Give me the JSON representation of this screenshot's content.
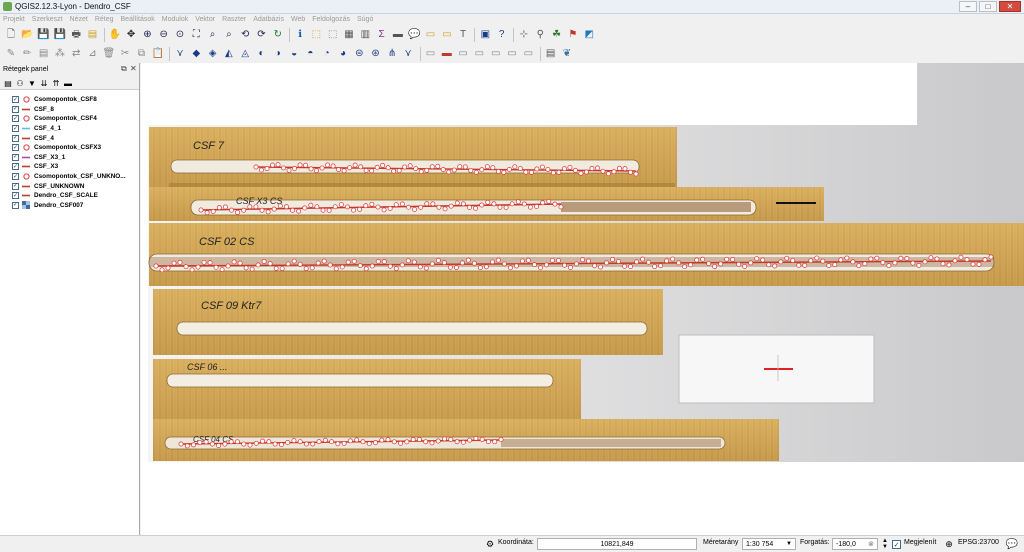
{
  "window": {
    "title": "QGIS2.12.3-Lyon - Dendro_CSF",
    "controls": [
      "–",
      "□",
      "✕"
    ]
  },
  "menu": [
    "Projekt",
    "Szerkeszt",
    "Nézet",
    "Réteg",
    "Beállítások",
    "Modulok",
    "Vektor",
    "Raszter",
    "Adatbázis",
    "Web",
    "Feldolgozás",
    "Súgó"
  ],
  "toolbar1": [
    {
      "icon": "new-project-icon",
      "glyph": "🗋",
      "color": "#555"
    },
    {
      "icon": "open-project-icon",
      "glyph": "📂",
      "color": "#c9a227"
    },
    {
      "icon": "save-project-icon",
      "glyph": "💾",
      "color": "#3b6ea5"
    },
    {
      "icon": "save-as-icon",
      "glyph": "💾",
      "color": "#3b6ea5"
    },
    {
      "icon": "print-composer-icon",
      "glyph": "🖶",
      "color": "#555"
    },
    {
      "icon": "composer-manager-icon",
      "glyph": "▤",
      "color": "#c9a227"
    },
    {
      "icon": "pan-icon",
      "glyph": "✋",
      "color": "#222"
    },
    {
      "icon": "pan-to-selection-icon",
      "glyph": "✥",
      "color": "#222"
    },
    {
      "icon": "zoom-in-icon",
      "glyph": "⊕",
      "color": "#225"
    },
    {
      "icon": "zoom-out-icon",
      "glyph": "⊖",
      "color": "#225"
    },
    {
      "icon": "zoom-actual-icon",
      "glyph": "⊙",
      "color": "#225"
    },
    {
      "icon": "zoom-full-icon",
      "glyph": "⛶",
      "color": "#225"
    },
    {
      "icon": "zoom-selection-icon",
      "glyph": "⌕",
      "color": "#225"
    },
    {
      "icon": "zoom-layer-icon",
      "glyph": "⌕",
      "color": "#225"
    },
    {
      "icon": "zoom-last-icon",
      "glyph": "⟲",
      "color": "#225"
    },
    {
      "icon": "zoom-next-icon",
      "glyph": "⟳",
      "color": "#225"
    },
    {
      "icon": "refresh-icon",
      "glyph": "↻",
      "color": "#2a7a2a"
    },
    {
      "icon": "identify-icon",
      "glyph": "ℹ",
      "color": "#1a5aa5"
    },
    {
      "icon": "select-features-icon",
      "glyph": "⬚",
      "color": "#c9a227"
    },
    {
      "icon": "deselect-icon",
      "glyph": "⬚",
      "color": "#888"
    },
    {
      "icon": "open-attribute-table-icon",
      "glyph": "▦",
      "color": "#555"
    },
    {
      "icon": "field-calculator-icon",
      "glyph": "▥",
      "color": "#555"
    },
    {
      "icon": "statistics-icon",
      "glyph": "Σ",
      "color": "#8a2a8a"
    },
    {
      "icon": "measure-icon",
      "glyph": "▬",
      "color": "#555"
    },
    {
      "icon": "map-tips-icon",
      "glyph": "💬",
      "color": "#c9a227"
    },
    {
      "icon": "new-bookmark-icon",
      "glyph": "▭",
      "color": "#c9a227"
    },
    {
      "icon": "show-bookmarks-icon",
      "glyph": "▭",
      "color": "#c9a227"
    },
    {
      "icon": "text-annotation-icon",
      "glyph": "T",
      "color": "#555"
    },
    {
      "icon": "help-book-icon",
      "glyph": "▣",
      "color": "#1a3a8a"
    },
    {
      "icon": "whats-this-icon",
      "glyph": "?",
      "color": "#1a3a8a"
    },
    {
      "icon": "gps-icon",
      "glyph": "⊹",
      "color": "#555"
    },
    {
      "icon": "georeferencer-icon",
      "glyph": "⚲",
      "color": "#555"
    },
    {
      "icon": "plugin-a-icon",
      "glyph": "☘",
      "color": "#2a7a2a"
    },
    {
      "icon": "plugin-b-icon",
      "glyph": "⚑",
      "color": "#c0392b"
    },
    {
      "icon": "plugin-c-icon",
      "glyph": "◩",
      "color": "#1a7abf"
    }
  ],
  "toolbar2": [
    {
      "icon": "current-edits-icon",
      "glyph": "✎",
      "color": "#888"
    },
    {
      "icon": "toggle-editing-icon",
      "glyph": "✏",
      "color": "#888"
    },
    {
      "icon": "save-edits-icon",
      "glyph": "▤",
      "color": "#888"
    },
    {
      "icon": "add-feature-icon",
      "glyph": "⁂",
      "color": "#888"
    },
    {
      "icon": "move-feature-icon",
      "glyph": "⇄",
      "color": "#888"
    },
    {
      "icon": "node-tool-icon",
      "glyph": "⊿",
      "color": "#888"
    },
    {
      "icon": "delete-selected-icon",
      "glyph": "🗑",
      "color": "#888"
    },
    {
      "icon": "cut-features-icon",
      "glyph": "✂",
      "color": "#888"
    },
    {
      "icon": "copy-features-icon",
      "glyph": "⧉",
      "color": "#888"
    },
    {
      "icon": "paste-features-icon",
      "glyph": "📋",
      "color": "#888"
    },
    {
      "icon": "adv-digitize-a-icon",
      "glyph": "⋎",
      "color": "#1a3a8a"
    },
    {
      "icon": "adv-digitize-b-icon",
      "glyph": "◆",
      "color": "#1a3a8a"
    },
    {
      "icon": "adv-digitize-c-icon",
      "glyph": "◈",
      "color": "#1a3a8a"
    },
    {
      "icon": "adv-digitize-d-icon",
      "glyph": "◭",
      "color": "#1a3a8a"
    },
    {
      "icon": "adv-digitize-e-icon",
      "glyph": "◬",
      "color": "#1a3a8a"
    },
    {
      "icon": "adv-digitize-f-icon",
      "glyph": "◐",
      "color": "#1a3a8a"
    },
    {
      "icon": "adv-digitize-g-icon",
      "glyph": "◑",
      "color": "#1a3a8a"
    },
    {
      "icon": "adv-digitize-h-icon",
      "glyph": "◒",
      "color": "#1a3a8a"
    },
    {
      "icon": "adv-digitize-i-icon",
      "glyph": "◓",
      "color": "#1a3a8a"
    },
    {
      "icon": "adv-digitize-j-icon",
      "glyph": "◔",
      "color": "#1a3a8a"
    },
    {
      "icon": "adv-digitize-k-icon",
      "glyph": "◕",
      "color": "#1a3a8a"
    },
    {
      "icon": "adv-digitize-l-icon",
      "glyph": "⊜",
      "color": "#1a3a8a"
    },
    {
      "icon": "adv-digitize-m-icon",
      "glyph": "⊛",
      "color": "#1a3a8a"
    },
    {
      "icon": "adv-digitize-n-icon",
      "glyph": "⋔",
      "color": "#1a3a8a"
    },
    {
      "icon": "adv-digitize-o-icon",
      "glyph": "⋎",
      "color": "#1a3a8a"
    },
    {
      "icon": "label-a-icon",
      "glyph": "▭",
      "color": "#888"
    },
    {
      "icon": "label-b-icon",
      "glyph": "▬",
      "color": "#c0392b"
    },
    {
      "icon": "label-c-icon",
      "glyph": "▭",
      "color": "#888"
    },
    {
      "icon": "label-d-icon",
      "glyph": "▭",
      "color": "#888"
    },
    {
      "icon": "label-e-icon",
      "glyph": "▭",
      "color": "#888"
    },
    {
      "icon": "label-f-icon",
      "glyph": "▭",
      "color": "#888"
    },
    {
      "icon": "label-g-icon",
      "glyph": "▭",
      "color": "#888"
    },
    {
      "icon": "csw-icon",
      "glyph": "▤",
      "color": "#555"
    },
    {
      "icon": "python-console-icon",
      "glyph": "❦",
      "color": "#3b6ea5"
    }
  ],
  "layers_panel": {
    "title": "Rétegek panel",
    "tools": [
      {
        "icon": "open-layer-styling-icon",
        "glyph": "▤"
      },
      {
        "icon": "add-group-icon",
        "glyph": "⚇"
      },
      {
        "icon": "filter-legend-icon",
        "glyph": "▼"
      },
      {
        "icon": "expand-all-icon",
        "glyph": "⇊"
      },
      {
        "icon": "collapse-all-icon",
        "glyph": "⇈"
      },
      {
        "icon": "remove-layer-icon",
        "glyph": "▬"
      }
    ],
    "layers": [
      {
        "name": "Csomopontok_CSF8",
        "checked": true,
        "symbol": "circle",
        "color": "#e04040"
      },
      {
        "name": "CSF_8",
        "checked": true,
        "symbol": "line",
        "color": "#c0392b"
      },
      {
        "name": "Csomopontok_CSF4",
        "checked": true,
        "symbol": "circle",
        "color": "#e04040"
      },
      {
        "name": "CSF_4_1",
        "checked": true,
        "symbol": "line",
        "color": "#5bc0de"
      },
      {
        "name": "CSF_4",
        "checked": true,
        "symbol": "line",
        "color": "#c0392b"
      },
      {
        "name": "Csomopontok_CSFX3",
        "checked": true,
        "symbol": "circle",
        "color": "#e04040"
      },
      {
        "name": "CSF_X3_1",
        "checked": true,
        "symbol": "line",
        "color": "#c03fb0"
      },
      {
        "name": "CSF_X3",
        "checked": true,
        "symbol": "line",
        "color": "#c0392b"
      },
      {
        "name": "Csomopontok_CSF_UNKNO...",
        "checked": true,
        "symbol": "circle",
        "color": "#e04040"
      },
      {
        "name": "CSF_UNKNOWN",
        "checked": true,
        "symbol": "line",
        "color": "#c0392b"
      },
      {
        "name": "Dendro_CSF_SCALE",
        "checked": true,
        "symbol": "line",
        "color": "#c0392b"
      },
      {
        "name": "Dendro_CSF007",
        "checked": true,
        "symbol": "raster",
        "color": "#3b6ea5"
      }
    ]
  },
  "map": {
    "cores": [
      {
        "label": "CSF 7",
        "points": true
      },
      {
        "label": "CSF X3 CS",
        "points": true
      },
      {
        "label": "CSF 02 CS",
        "points": true
      },
      {
        "label": "CSF 09 Ktr7",
        "points": false
      },
      {
        "label": "CSF 06 ...",
        "points": false
      },
      {
        "label": "CSF 04 CS",
        "points": true
      }
    ]
  },
  "status": {
    "coord_label": "Koordináta:",
    "coord_value": "10821,849",
    "scale_label": "Méretarány",
    "scale_value": "1:30 754",
    "rotation_label": "Forgatás:",
    "rotation_value": "-180,0",
    "render_label": "Megjelenít",
    "render_checked": true,
    "crs_label": "EPSG:23700"
  }
}
